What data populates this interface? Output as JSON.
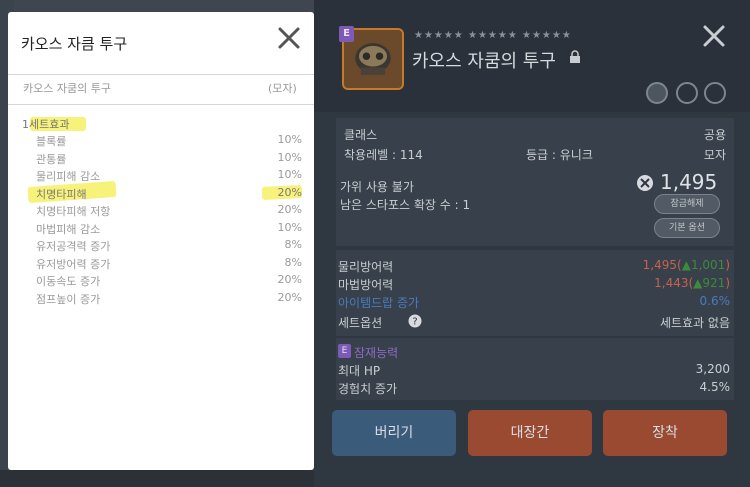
{
  "popup": {
    "title": "카오스 자큼 투구",
    "item_name": "카오스 자쿰의 투구",
    "item_type": "(모자)",
    "set_label": "1세트효과",
    "effects": [
      {
        "label": "블록률",
        "value": "10%"
      },
      {
        "label": "관통률",
        "value": "10%"
      },
      {
        "label": "물리피해 감소",
        "value": "10%"
      },
      {
        "label": "치명타피해",
        "value": "20%"
      },
      {
        "label": "치명타피해 저항",
        "value": "20%"
      },
      {
        "label": "마법피해 감소",
        "value": "10%"
      },
      {
        "label": "유저공격력 증가",
        "value": "8%"
      },
      {
        "label": "유저방어력 증가",
        "value": "8%"
      },
      {
        "label": "이동속도 증가",
        "value": "20%"
      },
      {
        "label": "점프높이 증가",
        "value": "20%"
      }
    ],
    "highlight_color": "#f7f27a"
  },
  "detail": {
    "rarity": "E",
    "stars": "★★★★★ ★★★★★ ★★★★★",
    "title": "카오스 자쿰의 투구",
    "class_label": "클래스",
    "class_value": "공용",
    "level_label": "착용레벨 : 114",
    "grade_label": "등급 : 유니크",
    "type_value": "모자",
    "scissors_label": "가위 사용 불가",
    "starforce_label": "남은 스타포스 확장 수 : 1",
    "power": "1,495",
    "unlock_btn": "잠금해제",
    "base_option_btn": "기본 옵션",
    "stats": [
      {
        "label": "물리방어력",
        "value": "1,495(",
        "bonus": "▲1,001",
        "close": ")",
        "color": "#c5624a"
      },
      {
        "label": "마법방어력",
        "value": "1,443(",
        "bonus": "▲921",
        "close": ")",
        "color": "#c5624a"
      },
      {
        "label": "아이템드랍 증가",
        "value": "0.6%",
        "bonus": "",
        "close": "",
        "color": "#4a7bbd"
      }
    ],
    "set_option_label": "세트옵션",
    "set_option_value": "세트효과 없음",
    "potential_badge": "E",
    "potential_label": "잠재능력",
    "potentials": [
      {
        "label": "최대 HP",
        "value": "3,200"
      },
      {
        "label": "경험치 증가",
        "value": "4.5%"
      }
    ],
    "discard_label": "버리기",
    "auction_label": "대장간",
    "equip_label": "장착"
  }
}
